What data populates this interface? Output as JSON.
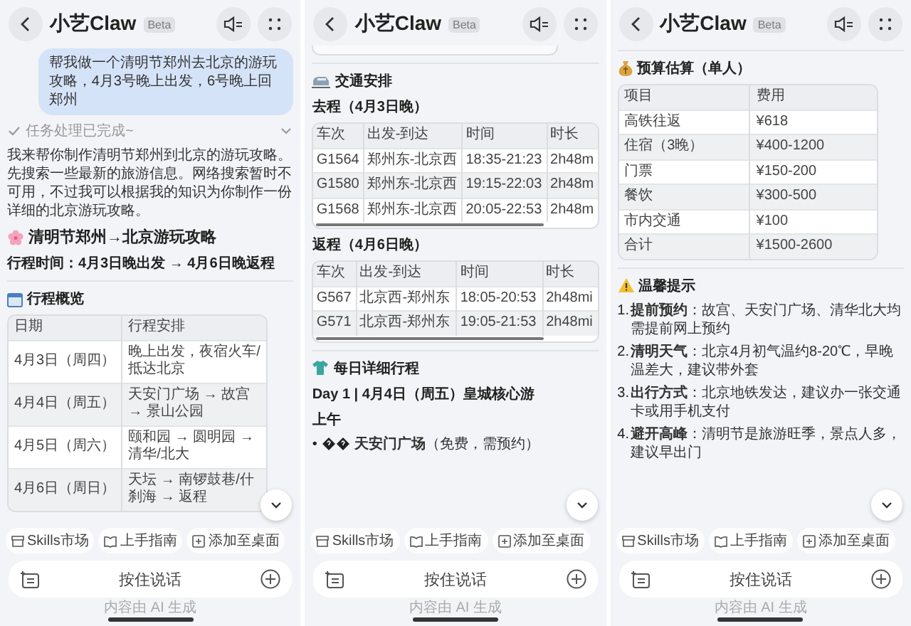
{
  "panels": [
    {
      "header": {
        "title": "小艺Claw",
        "badge": "Beta"
      },
      "content": [
        {
          "kind": "user_message",
          "text": "帮我做一个清明节郑州去北京的游玩攻略，4月3号晚上出发，6号晚上回郑州"
        },
        {
          "kind": "status",
          "text": "任务处理已完成~",
          "expanded": false
        },
        {
          "kind": "paragraph",
          "text": "我来帮你制作清明节郑州到北京的游玩攻略。先搜索一些最新的旅游信息。网络搜索暂时不可用，不过我可以根据我的知识为你制作一份详细的北京游玩攻略。"
        },
        {
          "kind": "title_heading",
          "text": "清明节郑州→北京游玩攻略"
        },
        {
          "kind": "bold_line",
          "text": "行程时间：4月3日晚出发 → 4月6日晚返程"
        },
        {
          "kind": "overview_heading",
          "text": "行程概览"
        },
        {
          "kind": "table",
          "scrollable": false,
          "columns": [
            "日期",
            "行程安排"
          ],
          "rows": [
            [
              "4月3日（周四）",
              "晚上出发，夜宿火车/抵达北京"
            ],
            [
              "4月4日（周五）",
              "天安门广场 → 故宫 → 景山公园"
            ],
            [
              "4月5日（周六）",
              "颐和园 → 圆明园 → 清华/北大"
            ],
            [
              "4月6日（周日）",
              "天坛 → 南锣鼓巷/什刹海 → 返程"
            ]
          ]
        }
      ],
      "chips": [
        "Skills市场",
        "上手指南",
        "添加至桌面"
      ],
      "input": {
        "label": "按住说话"
      },
      "footer": "内容由 AI 生成"
    },
    {
      "header": {
        "title": "小艺Claw",
        "badge": "Beta"
      },
      "content": [
        {
          "kind": "table_end"
        },
        {
          "kind": "transport_heading",
          "text": "交通安排"
        },
        {
          "kind": "bold_line",
          "text": "去程（4月3日晚）"
        },
        {
          "kind": "table",
          "scrollable": true,
          "columns": [
            "车次",
            "出发-到达",
            "时间",
            "时长"
          ],
          "rows": [
            [
              "G1564",
              "郑州东-北京西",
              "18:35-21:23",
              "2h48m"
            ],
            [
              "G1580",
              "郑州东-北京西",
              "19:15-22:03",
              "2h48m"
            ],
            [
              "G1568",
              "郑州东-北京西",
              "20:05-22:53",
              "2h48m"
            ]
          ]
        },
        {
          "kind": "bold_line",
          "text": "返程（4月6日晚）"
        },
        {
          "kind": "table",
          "scrollable": true,
          "columns": [
            "车次",
            "出发-到达",
            "时间",
            "时长"
          ],
          "rows": [
            [
              "G567",
              "北京西-郑州东",
              "18:05-20:53",
              "2h48mi"
            ],
            [
              "G571",
              "北京西-郑州东",
              "19:05-21:53",
              "2h48mi"
            ]
          ]
        },
        {
          "kind": "daily_heading",
          "text": "每日详细行程"
        },
        {
          "kind": "bold_line",
          "text": "Day 1 | 4月4日（周五）皇城核心游"
        },
        {
          "kind": "bold_line",
          "text": "上午"
        },
        {
          "kind": "bullet_item",
          "bullet": "•",
          "text": "**天安门广场**（免费，需预约）"
        }
      ],
      "chips": [
        "Skills市场",
        "上手指南",
        "添加至桌面"
      ],
      "input": {
        "label": "按住说话"
      },
      "footer": "内容由 AI 生成"
    },
    {
      "header": {
        "title": "小艺Claw",
        "badge": "Beta"
      },
      "content": [
        {
          "kind": "budget_heading",
          "text": "预算估算（单人）"
        },
        {
          "kind": "table",
          "scrollable": false,
          "columns": [
            "项目",
            "费用"
          ],
          "rows": [
            [
              "高铁往返",
              "¥618"
            ],
            [
              "住宿（3晚）",
              "¥400-1200"
            ],
            [
              "门票",
              "¥150-200"
            ],
            [
              "餐饮",
              "¥300-500"
            ],
            [
              "市内交通",
              "¥100"
            ],
            [
              "合计",
              "¥1500-2600"
            ]
          ]
        },
        {
          "kind": "tips_heading",
          "text": "温馨提示"
        },
        {
          "kind": "numbered_list",
          "items": [
            {
              "number": "1.",
              "text": "**提前预约**：故宫、天安门广场、清华北大均需提前网上预约"
            },
            {
              "number": "2.",
              "text": "**清明天气**：北京4月初气温约8-20℃，早晚温差大，建议带外套"
            },
            {
              "number": "3.",
              "text": "**出行方式**：北京地铁发达，建议办一张交通卡或用手机支付"
            },
            {
              "number": "4.",
              "text": "**避开高峰**：清明节是旅游旺季，景点人多，建议早出门"
            }
          ]
        }
      ],
      "chips": [
        "Skills市场",
        "上手指南",
        "添加至桌面"
      ],
      "input": {
        "label": "按住说话"
      },
      "footer": "内容由 AI 生成"
    }
  ]
}
